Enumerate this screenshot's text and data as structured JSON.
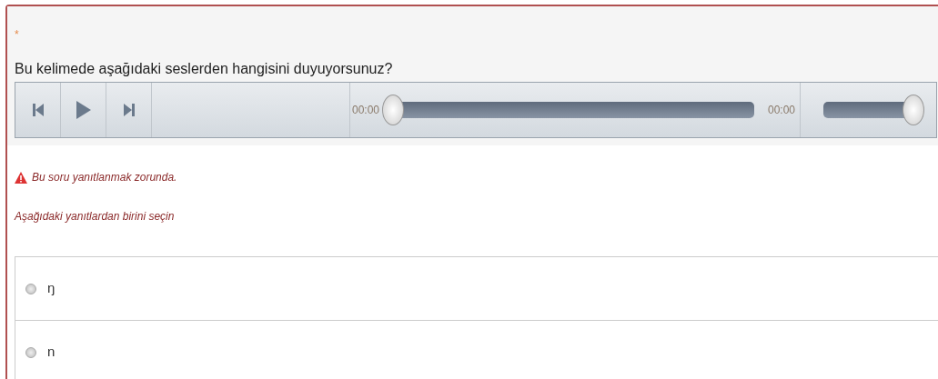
{
  "question": {
    "required_mark": "*",
    "text": "Bu kelimede aşağıdaki seslerden hangisini duyuyorsunuz?"
  },
  "player": {
    "current_time": "00:00",
    "duration": "00:00",
    "progress": {
      "level": 0
    },
    "volume": {
      "level": 1
    }
  },
  "warning": "Bu soru yanıtlanmak zorunda.",
  "instruction": "Aşağıdaki yanıtlardan birini seçin",
  "options": [
    {
      "label": "ŋ",
      "selected": false
    },
    {
      "label": "n",
      "selected": false
    }
  ]
}
